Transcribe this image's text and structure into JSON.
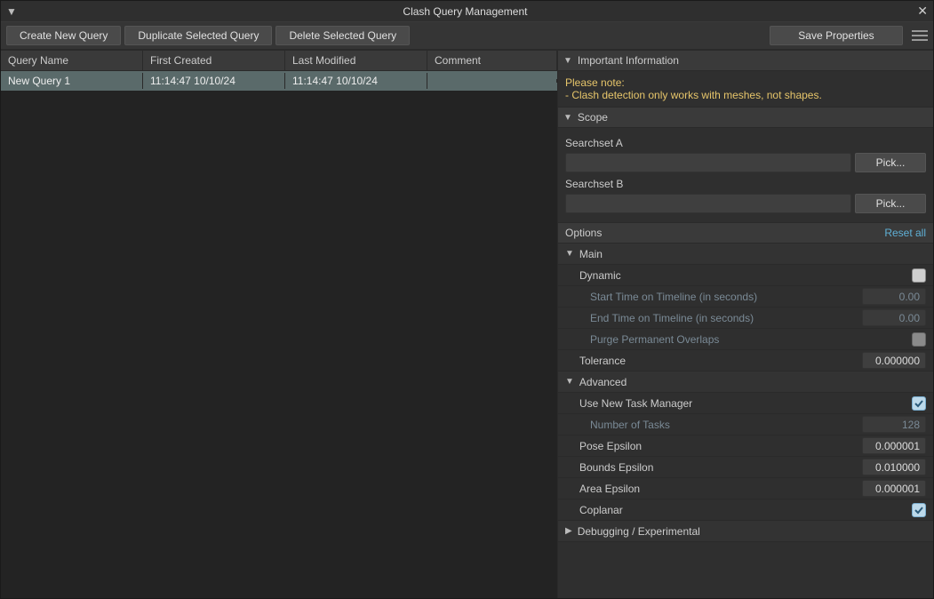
{
  "window": {
    "title": "Clash Query Management"
  },
  "toolbar": {
    "create": "Create New Query",
    "duplicate": "Duplicate Selected Query",
    "delete": "Delete Selected Query",
    "save": "Save Properties"
  },
  "table": {
    "headers": {
      "name": "Query Name",
      "created": "First Created",
      "modified": "Last Modified",
      "comment": "Comment"
    },
    "rows": [
      {
        "name": "New Query 1",
        "created": "11:14:47 10/10/24",
        "modified": "11:14:47 10/10/24",
        "comment": ""
      }
    ]
  },
  "info": {
    "header": "Important Information",
    "note_title": "Please note:",
    "note_body": "- Clash detection only works with meshes, not shapes."
  },
  "scope": {
    "header": "Scope",
    "a_label": "Searchset A",
    "b_label": "Searchset B",
    "pick": "Pick..."
  },
  "options": {
    "label": "Options",
    "reset": "Reset all"
  },
  "main": {
    "header": "Main",
    "dynamic": "Dynamic",
    "start_time": "Start Time on Timeline (in seconds)",
    "end_time": "End Time on Timeline (in seconds)",
    "purge": "Purge Permanent Overlaps",
    "tolerance": "Tolerance",
    "start_val": "0.00",
    "end_val": "0.00",
    "tol_val": "0.000000"
  },
  "advanced": {
    "header": "Advanced",
    "new_task_mgr": "Use New Task Manager",
    "num_tasks": "Number of Tasks",
    "num_tasks_val": "128",
    "pose_eps": "Pose Epsilon",
    "pose_eps_val": "0.000001",
    "bounds_eps": "Bounds Epsilon",
    "bounds_eps_val": "0.010000",
    "area_eps": "Area Epsilon",
    "area_eps_val": "0.000001",
    "coplanar": "Coplanar"
  },
  "debug": {
    "header": "Debugging / Experimental"
  }
}
